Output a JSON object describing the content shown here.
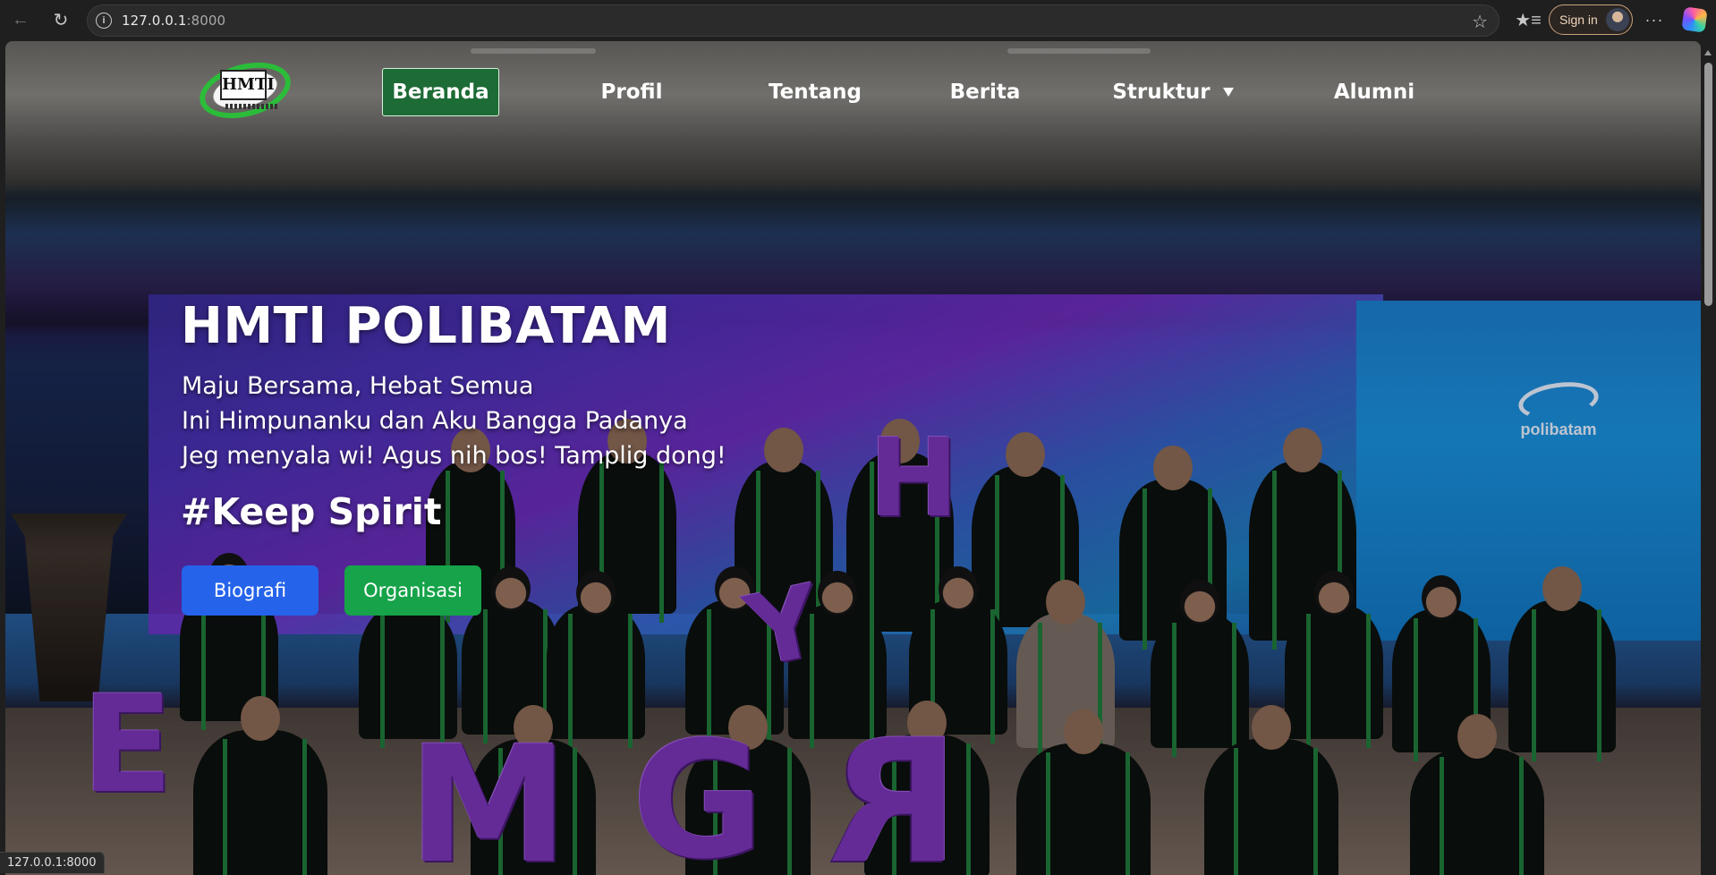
{
  "browser": {
    "url_host": "127.0.0.1",
    "url_port": ":8000",
    "signin_label": "Sign in",
    "status_url": "127.0.0.1:8000"
  },
  "site": {
    "logo_text": "HMTI",
    "nav": {
      "beranda": "Beranda",
      "profil": "Profil",
      "tentang": "Tentang",
      "berita": "Berita",
      "struktur": "Struktur",
      "alumni": "Alumni"
    },
    "active_nav": "Beranda"
  },
  "hero": {
    "title": "HMTI POLIBATAM",
    "lines": [
      "Maju Bersama, Hebat Semua",
      "Ini Himpunanku dan Aku Bangga Padanya",
      "Jeg menyala wi! Agus nih bos! Tamplig dong!"
    ],
    "tagline": "#Keep Spirit",
    "buttons": {
      "biografi": "Biografi",
      "organisasi": "Organisasi"
    },
    "background_letters": [
      "H",
      "Y",
      "E",
      "M",
      "G",
      "R"
    ],
    "banner_brand": "polibatam"
  },
  "colors": {
    "nav_active_bg": "#1d6b35",
    "btn_blue": "#2563eb",
    "btn_green": "#16a34a",
    "signin_border": "#c7a27a"
  },
  "icons": [
    "back-arrow-icon",
    "reload-icon",
    "info-icon",
    "star-icon",
    "favorites-icon",
    "more-icon",
    "copilot-icon",
    "caret-down-icon"
  ]
}
